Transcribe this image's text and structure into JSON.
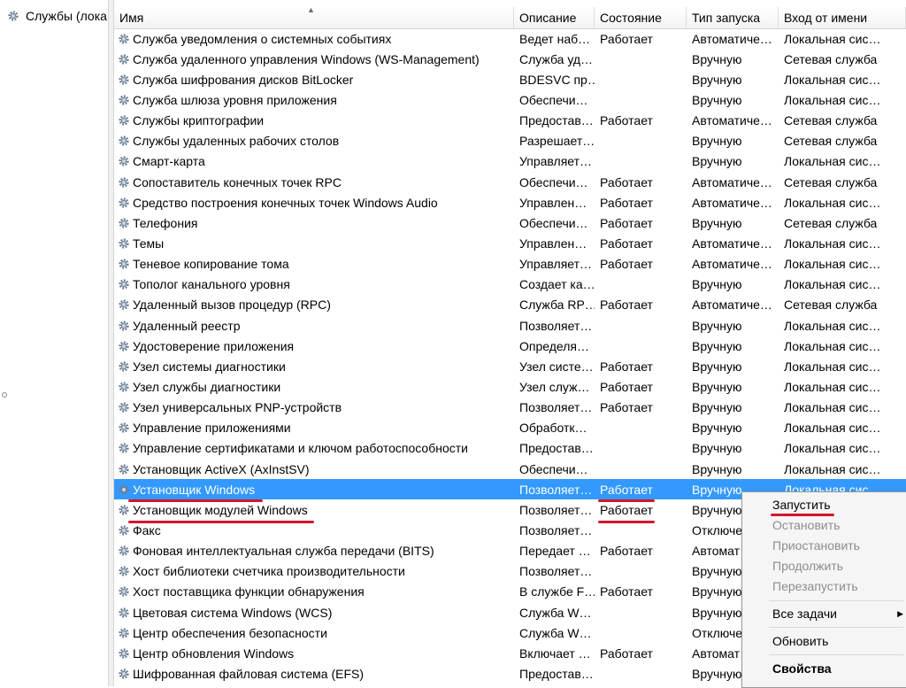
{
  "tree": {
    "label": "Службы (лока"
  },
  "columns": {
    "name": "Имя",
    "description": "Описание",
    "state": "Состояние",
    "startup": "Тип запуска",
    "logon": "Вход от имени"
  },
  "rows": [
    {
      "name": "Служба уведомления о системных событиях",
      "desc": "Ведет наб…",
      "state": "Работает",
      "type": "Автоматиче…",
      "logon": "Локальная сис…"
    },
    {
      "name": "Служба удаленного управления Windows (WS-Management)",
      "desc": "Служба уд…",
      "state": "",
      "type": "Вручную",
      "logon": "Сетевая служба"
    },
    {
      "name": "Служба шифрования дисков BitLocker",
      "desc": "BDESVC пр…",
      "state": "",
      "type": "Вручную",
      "logon": "Локальная сис…"
    },
    {
      "name": "Служба шлюза уровня приложения",
      "desc": "Обеспечи…",
      "state": "",
      "type": "Вручную",
      "logon": "Локальная сис…"
    },
    {
      "name": "Службы криптографии",
      "desc": "Предостав…",
      "state": "Работает",
      "type": "Автоматиче…",
      "logon": "Сетевая служба"
    },
    {
      "name": "Службы удаленных рабочих столов",
      "desc": "Разрешает…",
      "state": "",
      "type": "Вручную",
      "logon": "Сетевая служба"
    },
    {
      "name": "Смарт-карта",
      "desc": "Управляет…",
      "state": "",
      "type": "Вручную",
      "logon": "Локальная сис…"
    },
    {
      "name": "Сопоставитель конечных точек RPC",
      "desc": "Обеспечи…",
      "state": "Работает",
      "type": "Автоматиче…",
      "logon": "Сетевая служба"
    },
    {
      "name": "Средство построения конечных точек Windows Audio",
      "desc": "Управлен…",
      "state": "Работает",
      "type": "Автоматиче…",
      "logon": "Локальная сис…"
    },
    {
      "name": "Телефония",
      "desc": "Обеспечи…",
      "state": "Работает",
      "type": "Вручную",
      "logon": "Сетевая служба"
    },
    {
      "name": "Темы",
      "desc": "Управлен…",
      "state": "Работает",
      "type": "Автоматиче…",
      "logon": "Локальная сис…"
    },
    {
      "name": "Теневое копирование тома",
      "desc": "Управляет…",
      "state": "Работает",
      "type": "Автоматиче…",
      "logon": "Локальная сис…"
    },
    {
      "name": "Тополог канального уровня",
      "desc": "Создает ка…",
      "state": "",
      "type": "Вручную",
      "logon": "Локальная сис…"
    },
    {
      "name": "Удаленный вызов процедур (RPC)",
      "desc": "Служба RP…",
      "state": "Работает",
      "type": "Автоматиче…",
      "logon": "Сетевая служба"
    },
    {
      "name": "Удаленный реестр",
      "desc": "Позволяет…",
      "state": "",
      "type": "Вручную",
      "logon": "Локальная сис…"
    },
    {
      "name": "Удостоверение приложения",
      "desc": "Определя…",
      "state": "",
      "type": "Вручную",
      "logon": "Локальная сис…"
    },
    {
      "name": "Узел системы диагностики",
      "desc": "Узел систе…",
      "state": "Работает",
      "type": "Вручную",
      "logon": "Локальная сис…"
    },
    {
      "name": "Узел службы диагностики",
      "desc": "Узел служ…",
      "state": "Работает",
      "type": "Вручную",
      "logon": "Локальная сис…"
    },
    {
      "name": "Узел универсальных PNP-устройств",
      "desc": "Позволяет…",
      "state": "Работает",
      "type": "Вручную",
      "logon": "Локальная сис…"
    },
    {
      "name": "Управление приложениями",
      "desc": "Обработк…",
      "state": "",
      "type": "Вручную",
      "logon": "Локальная сис…"
    },
    {
      "name": "Управление сертификатами и ключом работоспособности",
      "desc": "Предостав…",
      "state": "",
      "type": "Вручную",
      "logon": "Локальная сис…"
    },
    {
      "name": "Установщик ActiveX (AxInstSV)",
      "desc": "Обеспечи…",
      "state": "",
      "type": "Вручную",
      "logon": "Локальная сис…"
    },
    {
      "name": "Установщик Windows",
      "desc": "Позволяет…",
      "state": "Работает",
      "type": "Вручную",
      "logon": "Локальная сис…",
      "selected": true
    },
    {
      "name": "Установщик модулей Windows",
      "desc": "Позволяет…",
      "state": "Работает",
      "type": "Вручную",
      "logon": ""
    },
    {
      "name": "Факс",
      "desc": "Позволяет…",
      "state": "",
      "type": "Отключе",
      "logon": ""
    },
    {
      "name": "Фоновая интеллектуальная служба передачи (BITS)",
      "desc": "Передает …",
      "state": "Работает",
      "type": "Автомат",
      "logon": ""
    },
    {
      "name": "Хост библиотеки счетчика производительности",
      "desc": "Позволяет…",
      "state": "",
      "type": "Вручную",
      "logon": ""
    },
    {
      "name": "Хост поставщика функции обнаружения",
      "desc": "В службе F…",
      "state": "Работает",
      "type": "Вручную",
      "logon": ""
    },
    {
      "name": "Цветовая система Windows (WCS)",
      "desc": "Служба W…",
      "state": "",
      "type": "Вручную",
      "logon": ""
    },
    {
      "name": "Центр обеспечения безопасности",
      "desc": "Служба W…",
      "state": "",
      "type": "Отключе",
      "logon": ""
    },
    {
      "name": "Центр обновления Windows",
      "desc": "Включает …",
      "state": "Работает",
      "type": "Автомат",
      "logon": ""
    },
    {
      "name": "Шифрованная файловая система (EFS)",
      "desc": "Предостав…",
      "state": "",
      "type": "Вручную",
      "logon": ""
    }
  ],
  "context_menu": {
    "start": "Запустить",
    "stop": "Остановить",
    "pause": "Приостановить",
    "resume": "Продолжить",
    "restart": "Перезапустить",
    "all_tasks": "Все задачи",
    "refresh": "Обновить",
    "properties": "Свойства"
  },
  "colors": {
    "selection": "#3399ff",
    "annotation": "#d3182b"
  }
}
